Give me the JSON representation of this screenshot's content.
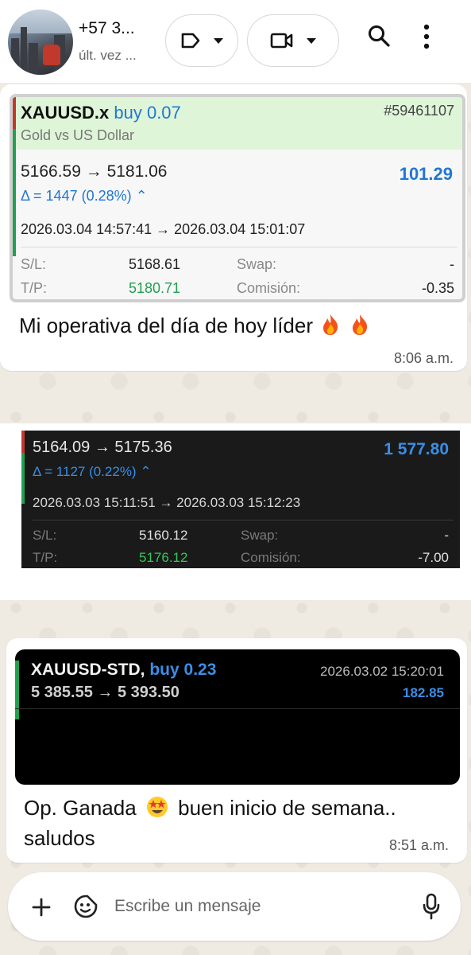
{
  "header": {
    "contact_name": "+57 3...",
    "contact_status": "últ. vez ...",
    "icons": [
      "label-icon",
      "video-call-icon",
      "search-icon",
      "more-icon"
    ]
  },
  "messages": [
    {
      "trade": {
        "symbol": "XAUUSD.x",
        "side": "buy 0.07",
        "ticket": "#59461107",
        "description": "Gold vs US Dollar",
        "prices": "5166.59 → 5181.06",
        "profit": "101.29",
        "delta": "Δ = 1447 (0.28%) ⌃",
        "times": "2026.03.04 14:57:41 → 2026.03.04 15:01:07",
        "sl_label": "S/L:",
        "sl_value": "5168.61",
        "tp_label": "T/P:",
        "tp_value": "5180.71",
        "swap_label": "Swap:",
        "swap_value": "-",
        "commission_label": "Comisión:",
        "commission_value": "-0.35"
      },
      "text": "Mi operativa del día de hoy líder",
      "emojis": [
        "fire-emoji",
        "fire-emoji"
      ],
      "time": "8:06 a.m."
    },
    {
      "trade": {
        "prices": "5164.09 → 5175.36",
        "profit": "1 577.80",
        "delta": "Δ = 1127 (0.22%) ⌃",
        "times": "2026.03.03 15:11:51 → 2026.03.03 15:12:23",
        "sl_label": "S/L:",
        "sl_value": "5160.12",
        "tp_label": "T/P:",
        "tp_value": "5176.12",
        "swap_label": "Swap:",
        "swap_value": "-",
        "commission_label": "Comisión:",
        "commission_value": "-7.00"
      }
    },
    {
      "trade": {
        "symbol": "XAUUSD-STD,",
        "side": "buy 0.23",
        "date": "2026.03.02 15:20:01",
        "prices": "5 385.55 → 5 393.50",
        "profit": "182.85"
      },
      "text_line1_before": "Op. Ganada",
      "text_line1_after": "buen inicio de semana..",
      "text_line2": "saludos",
      "emojis": [
        "star-struck-emoji"
      ],
      "time": "8:51 a.m."
    }
  ],
  "composer": {
    "placeholder": "Escribe un mensaje",
    "icons": [
      "plus-icon",
      "sticker-icon",
      "mic-icon"
    ]
  },
  "colors": {
    "chat_bg": "#efeae2",
    "buy_blue": "#1f77d4",
    "profit_green": "#21a051",
    "header_green": "#dff5d8"
  }
}
